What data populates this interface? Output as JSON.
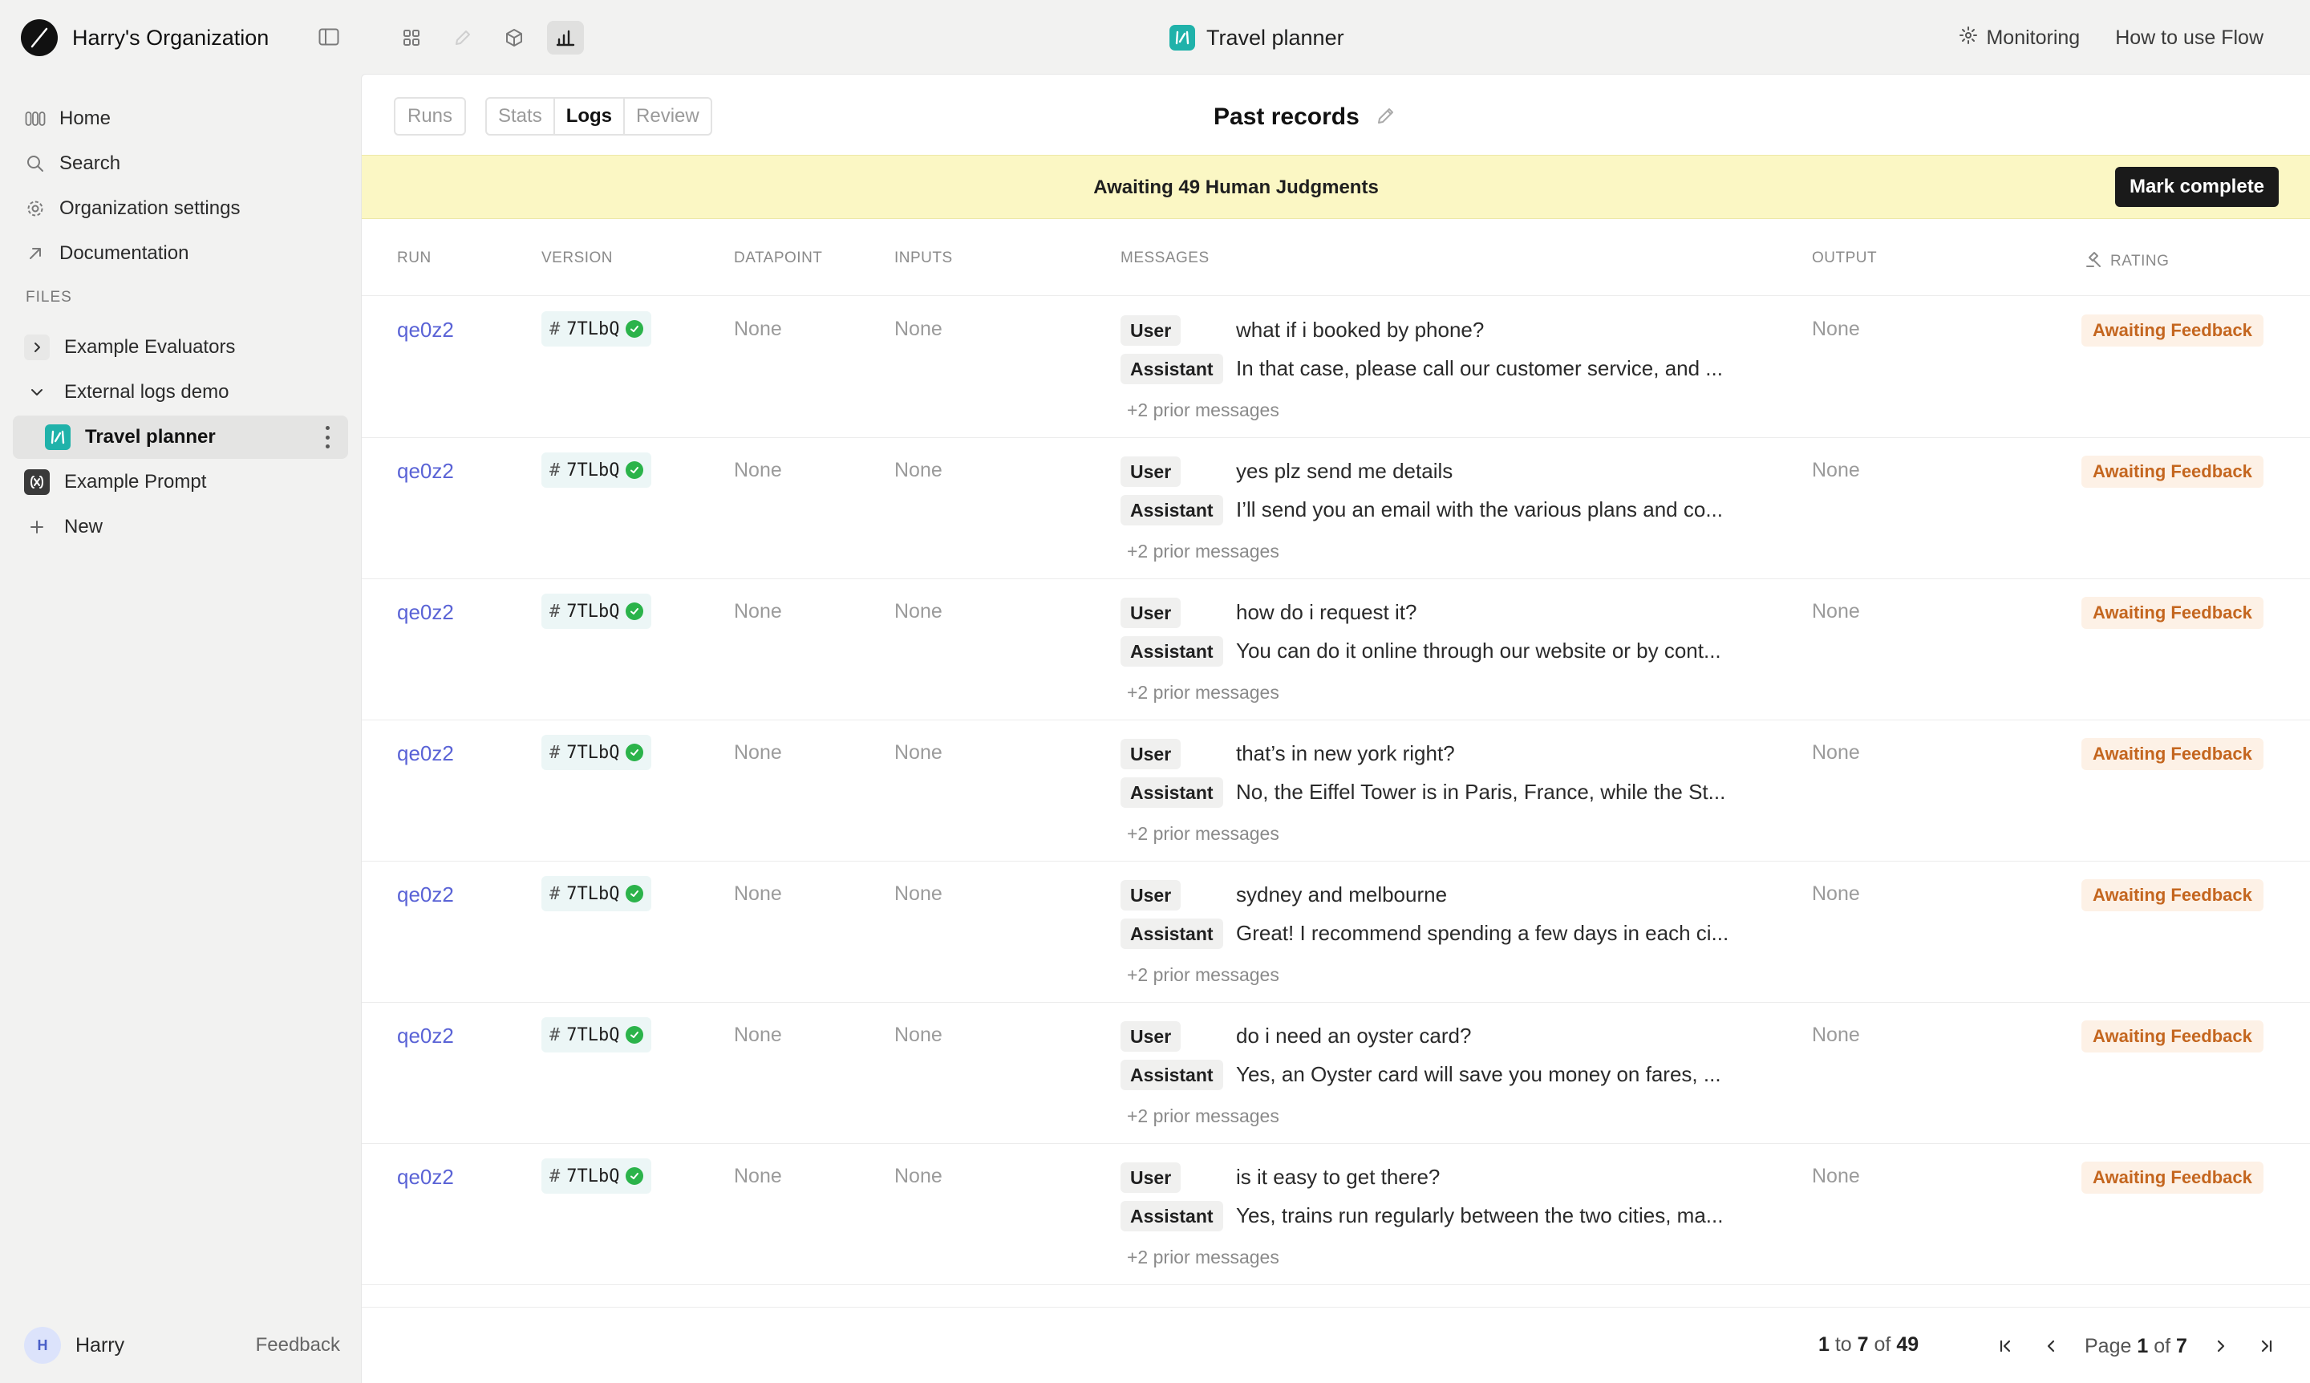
{
  "org": {
    "name": "Harry's Organization"
  },
  "app": {
    "title": "Travel planner"
  },
  "top_links": {
    "monitoring": "Monitoring",
    "how_to": "How to use Flow"
  },
  "sidebar": {
    "nav": [
      {
        "label": "Home",
        "icon": "home-icon"
      },
      {
        "label": "Search",
        "icon": "search-icon"
      },
      {
        "label": "Organization settings",
        "icon": "gear-icon"
      },
      {
        "label": "Documentation",
        "icon": "external-link-icon"
      }
    ],
    "files_heading": "FILES",
    "files": [
      {
        "label": "Example Evaluators",
        "icon": "chevron-right-icon"
      },
      {
        "label": "External logs demo",
        "icon": "chevron-down-icon"
      },
      {
        "label": "Travel planner",
        "icon": "flow-icon"
      },
      {
        "label": "Example Prompt",
        "icon": "prompt-icon"
      },
      {
        "label": "New",
        "icon": "plus-icon"
      }
    ],
    "user": {
      "initial": "H",
      "name": "Harry"
    },
    "feedback": "Feedback"
  },
  "toolbar": {
    "runs": "Runs",
    "tabs": [
      "Stats",
      "Logs",
      "Review"
    ],
    "active_tab": "Logs",
    "page_title": "Past records"
  },
  "banner": {
    "text": "Awaiting 49 Human Judgments",
    "button": "Mark complete"
  },
  "table": {
    "columns": {
      "run": "RUN",
      "version": "VERSION",
      "datapoint": "DATAPOINT",
      "inputs": "INPUTS",
      "messages": "MESSAGES",
      "output": "OUTPUT",
      "rating": "RATING"
    },
    "rows": [
      {
        "run": "qe0z2",
        "version": "7TLbQ",
        "datapoint": "None",
        "inputs": "None",
        "user_role": "User",
        "user_msg": "what if i booked by phone?",
        "assistant_role": "Assistant",
        "assistant_msg": "In that case, please call our customer service, and ...",
        "prior": "+2 prior messages",
        "output": "None",
        "rating": "Awaiting Feedback"
      },
      {
        "run": "qe0z2",
        "version": "7TLbQ",
        "datapoint": "None",
        "inputs": "None",
        "user_role": "User",
        "user_msg": "yes plz send me details",
        "assistant_role": "Assistant",
        "assistant_msg": "I’ll send you an email with the various plans and co...",
        "prior": "+2 prior messages",
        "output": "None",
        "rating": "Awaiting Feedback"
      },
      {
        "run": "qe0z2",
        "version": "7TLbQ",
        "datapoint": "None",
        "inputs": "None",
        "user_role": "User",
        "user_msg": "how do i request it?",
        "assistant_role": "Assistant",
        "assistant_msg": "You can do it online through our website or by cont...",
        "prior": "+2 prior messages",
        "output": "None",
        "rating": "Awaiting Feedback"
      },
      {
        "run": "qe0z2",
        "version": "7TLbQ",
        "datapoint": "None",
        "inputs": "None",
        "user_role": "User",
        "user_msg": "that’s in new york right?",
        "assistant_role": "Assistant",
        "assistant_msg": "No, the Eiffel Tower is in Paris, France, while the St...",
        "prior": "+2 prior messages",
        "output": "None",
        "rating": "Awaiting Feedback"
      },
      {
        "run": "qe0z2",
        "version": "7TLbQ",
        "datapoint": "None",
        "inputs": "None",
        "user_role": "User",
        "user_msg": "sydney and melbourne",
        "assistant_role": "Assistant",
        "assistant_msg": "Great! I recommend spending a few days in each ci...",
        "prior": "+2 prior messages",
        "output": "None",
        "rating": "Awaiting Feedback"
      },
      {
        "run": "qe0z2",
        "version": "7TLbQ",
        "datapoint": "None",
        "inputs": "None",
        "user_role": "User",
        "user_msg": "do i need an oyster card?",
        "assistant_role": "Assistant",
        "assistant_msg": "Yes, an Oyster card will save you money on fares, ...",
        "prior": "+2 prior messages",
        "output": "None",
        "rating": "Awaiting Feedback"
      },
      {
        "run": "qe0z2",
        "version": "7TLbQ",
        "datapoint": "None",
        "inputs": "None",
        "user_role": "User",
        "user_msg": "is it easy to get there?",
        "assistant_role": "Assistant",
        "assistant_msg": "Yes, trains run regularly between the two cities, ma...",
        "prior": "+2 prior messages",
        "output": "None",
        "rating": "Awaiting Feedback"
      }
    ]
  },
  "pagination": {
    "from": "1",
    "to_word": "to",
    "to": "7",
    "of_word": "of",
    "total": "49",
    "page_word": "Page",
    "page": "1",
    "page_of_word": "of",
    "pages": "7"
  },
  "colors": {
    "accent_link": "#5a63d6",
    "banner_bg": "#fbf7c4",
    "rating_text": "#c4661f",
    "rating_bg": "#fdf1e6",
    "flow_icon": "#20b2aa",
    "check_green": "#2bb34a"
  }
}
